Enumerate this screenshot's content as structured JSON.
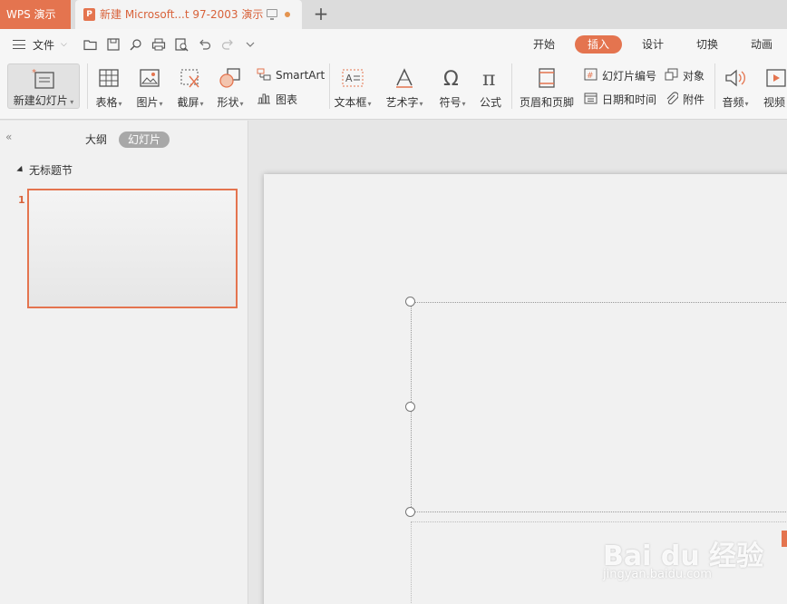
{
  "app_tab": "WPS 演示",
  "doc_tab": {
    "title": "新建 Microsoft...t 97-2003 演示",
    "icon_letter": "P"
  },
  "menu": {
    "file": "文件"
  },
  "ribbon_tabs": [
    "开始",
    "插入",
    "设计",
    "切换",
    "动画"
  ],
  "active_ribbon_tab": "插入",
  "ribbon": {
    "new_slide": "新建幻灯片",
    "table": "表格",
    "picture": "图片",
    "screenshot": "截屏",
    "shape": "形状",
    "smartart": "SmartArt",
    "chart": "图表",
    "textbox": "文本框",
    "wordart": "艺术字",
    "symbol": "符号",
    "formula": "公式",
    "header_footer": "页眉和页脚",
    "slide_number": "幻灯片编号",
    "object": "对象",
    "date_time": "日期和时间",
    "attachment": "附件",
    "audio": "音频",
    "video": "视频"
  },
  "left_pane": {
    "tabs": [
      "大纲",
      "幻灯片"
    ],
    "active_tab": "幻灯片",
    "section": "无标题节",
    "slide_number": "1"
  },
  "watermark": {
    "brand": "Bai du 经验",
    "url": "jingyan.baidu.com"
  },
  "colors": {
    "accent": "#e4744f",
    "accent_text": "#d8623a"
  }
}
